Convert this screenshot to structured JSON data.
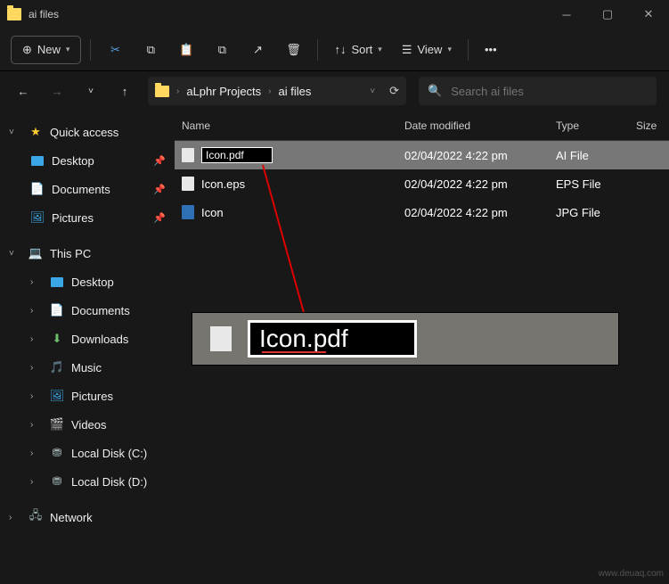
{
  "window": {
    "title": "ai files"
  },
  "toolbar": {
    "new_label": "New",
    "sort_label": "Sort",
    "view_label": "View"
  },
  "breadcrumbs": {
    "root": "aLphr Projects",
    "current": "ai files"
  },
  "search": {
    "placeholder": "Search ai files"
  },
  "columns": {
    "name": "Name",
    "date": "Date modified",
    "type": "Type",
    "size": "Size"
  },
  "files": [
    {
      "name": "Icon.pdf",
      "date": "02/04/2022 4:22 pm",
      "type": "AI File",
      "renaming": true
    },
    {
      "name": "Icon.eps",
      "date": "02/04/2022 4:22 pm",
      "type": "EPS File"
    },
    {
      "name": "Icon",
      "date": "02/04/2022 4:22 pm",
      "type": "JPG File"
    }
  ],
  "sidebar": {
    "quick_access": "Quick access",
    "desktop": "Desktop",
    "documents": "Documents",
    "pictures": "Pictures",
    "this_pc": "This PC",
    "downloads": "Downloads",
    "music": "Music",
    "videos": "Videos",
    "local_c": "Local Disk (C:)",
    "local_d": "Local Disk (D:)",
    "network": "Network"
  },
  "zoom_overlay": {
    "value": "Icon.pdf"
  },
  "watermark": "www.deuaq.com"
}
